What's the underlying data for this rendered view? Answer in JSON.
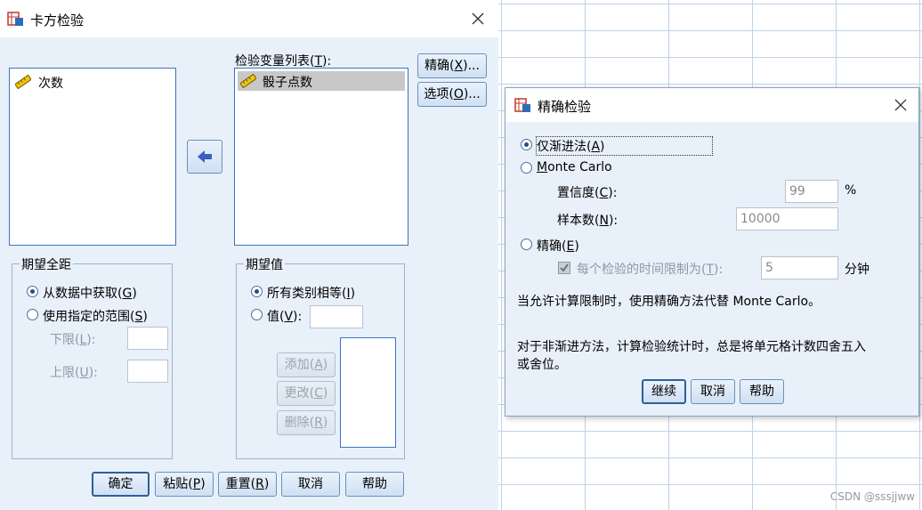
{
  "sheet": {
    "watermark": "CSDN @sssjjww"
  },
  "main_dialog": {
    "title": "卡方检验",
    "source_list": [
      "次数"
    ],
    "test_var_label": "检验变量列表(T):",
    "test_var_label_pre": "检验变量列表(",
    "test_var_label_key": "T",
    "test_var_label_post": "):",
    "test_vars": [
      "骰子点数"
    ],
    "exact_btn": {
      "pre": "精确(",
      "key": "X",
      "post": ")..."
    },
    "options_btn": {
      "pre": "选项(",
      "key": "O",
      "post": ")..."
    },
    "expected_range": {
      "title": "期望全距",
      "from_data": {
        "pre": "从数据中获取(",
        "key": "G",
        "post": ")"
      },
      "use_range": {
        "pre": "使用指定的范围(",
        "key": "S",
        "post": ")"
      },
      "lower": {
        "pre": "下限(",
        "key": "L",
        "post": "):"
      },
      "upper": {
        "pre": "上限(",
        "key": "U",
        "post": "):"
      }
    },
    "expected_values": {
      "title": "期望值",
      "all_equal": {
        "pre": "所有类别相等(",
        "key": "I",
        "post": ")"
      },
      "values": {
        "pre": "值(",
        "key": "V",
        "post": "):"
      },
      "add": {
        "pre": "添加(",
        "key": "A",
        "post": ")"
      },
      "change": {
        "pre": "更改(",
        "key": "C",
        "post": ")"
      },
      "remove": {
        "pre": "删除(",
        "key": "R",
        "post": ")"
      }
    },
    "buttons": {
      "ok": "确定",
      "paste": {
        "pre": "粘贴(",
        "key": "P",
        "post": ")"
      },
      "reset": {
        "pre": "重置(",
        "key": "R",
        "post": ")"
      },
      "cancel": "取消",
      "help": "帮助"
    }
  },
  "exact_dialog": {
    "title": "精确检验",
    "asymptotic": {
      "pre": "仅渐进法(",
      "key": "A",
      "post": ")"
    },
    "monte_carlo": {
      "key": "M",
      "post": "onte Carlo"
    },
    "confidence": {
      "pre": "置信度(",
      "key": "C",
      "post": "):",
      "value": "99",
      "unit": "%"
    },
    "samples": {
      "pre": "样本数(",
      "key": "N",
      "post": "):",
      "value": "10000"
    },
    "exact": {
      "pre": "精确(",
      "key": "E",
      "post": ")"
    },
    "time_limit": {
      "pre": "每个检验的时间限制为(",
      "key": "T",
      "post": "):",
      "value": "5",
      "unit": "分钟"
    },
    "note1": "当允许计算限制时，使用精确方法代替 Monte Carlo。",
    "note2_line1": "对于非渐进方法，计算检验统计时，总是将单元格计数四舍五入",
    "note2_line2": "或舍位。",
    "buttons": {
      "continue": "继续",
      "cancel": "取消",
      "help": "帮助"
    }
  }
}
